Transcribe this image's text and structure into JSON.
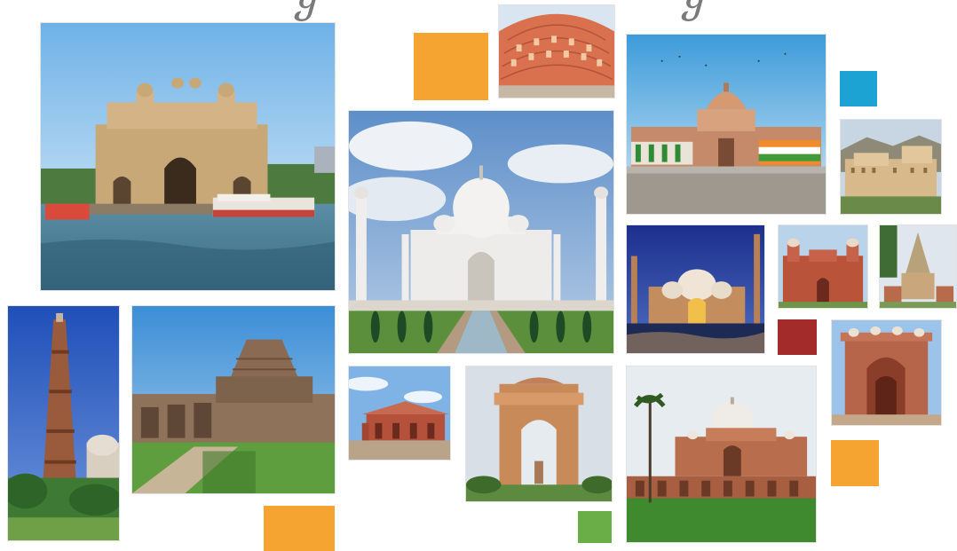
{
  "collage": {
    "colors": {
      "orange": "#F5A431",
      "blue": "#1CA3D3",
      "maroon": "#A32B2A",
      "green": "#6AAE48"
    },
    "tiles": [
      {
        "subject": "gateway-of-india"
      },
      {
        "subject": "hawa-mahal"
      },
      {
        "subject": "rashtrapati-bhavan"
      },
      {
        "subject": "taj-mahal"
      },
      {
        "subject": "amber-fort"
      },
      {
        "subject": "jama-masjid"
      },
      {
        "subject": "red-fort"
      },
      {
        "subject": "mahabodhi-temple"
      },
      {
        "subject": "qutub-minar"
      },
      {
        "subject": "konark-sun-temple"
      },
      {
        "subject": "red-fort-pavilion"
      },
      {
        "subject": "india-gate"
      },
      {
        "subject": "humayuns-tomb"
      },
      {
        "subject": "buland-darwaza"
      }
    ]
  }
}
